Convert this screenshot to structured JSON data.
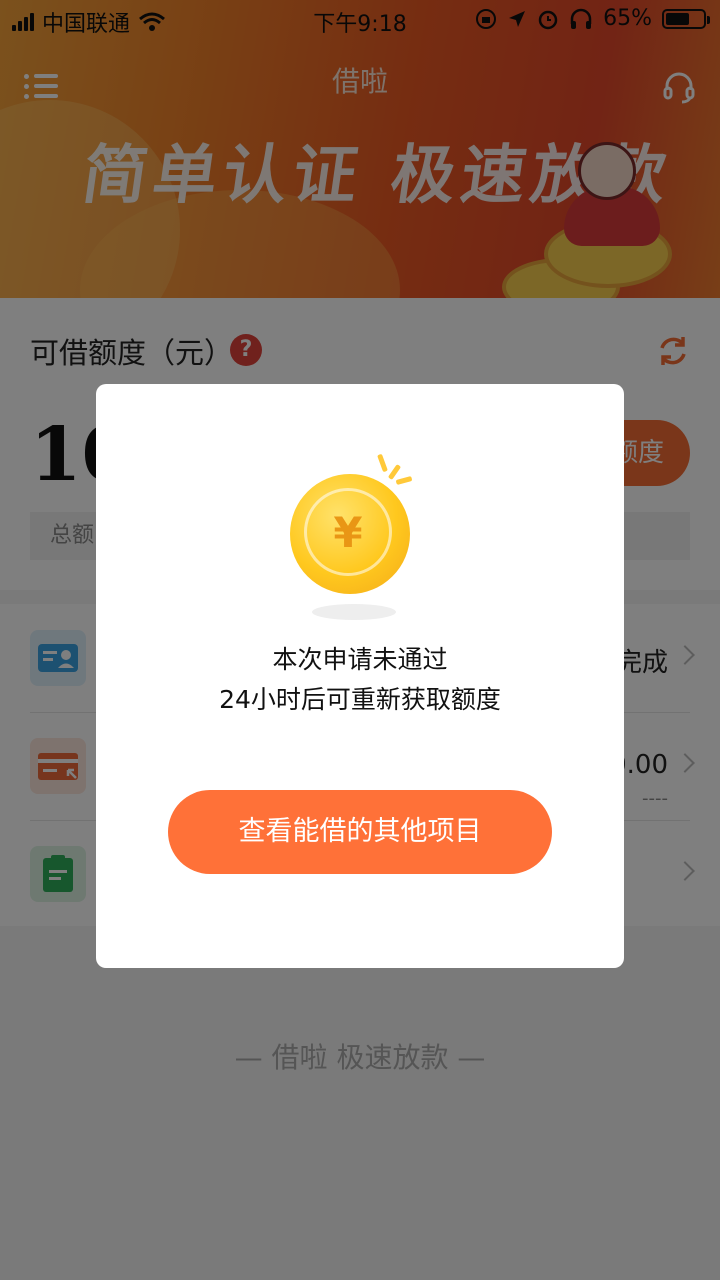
{
  "status_bar": {
    "carrier": "中国联通",
    "time": "下午9:18",
    "battery_percent": "65%",
    "battery_level": 0.65
  },
  "header": {
    "title": "借啦",
    "slogan": "简单认证 极速放款"
  },
  "limit_card": {
    "label": "可借额度（元）",
    "amount_partial": "10",
    "cta_partial": "额度",
    "total_partial": "总额"
  },
  "list": {
    "items": [
      {
        "value_partial": "完成",
        "sub": ""
      },
      {
        "value_partial": "0.00",
        "sub": "----"
      },
      {
        "value_partial": "",
        "sub": ""
      }
    ]
  },
  "footer": {
    "slogan": "借啦 极速放款"
  },
  "modal": {
    "coin_symbol": "¥",
    "message_line1": "本次申请未通过",
    "message_line2": "24小时后可重新获取额度",
    "button_label": "查看能借的其他项目"
  },
  "colors": {
    "accent": "#ff7138",
    "help": "#e0433a"
  }
}
